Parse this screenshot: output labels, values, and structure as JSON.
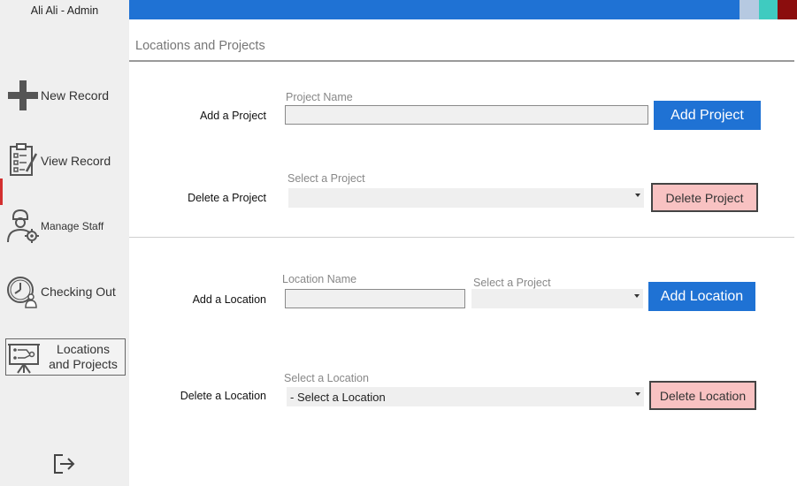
{
  "user": {
    "label": "Ali Ali - Admin"
  },
  "sidebar": {
    "items": [
      {
        "label": "New Record",
        "icon": "plus-icon"
      },
      {
        "label": "View Record",
        "icon": "clipboard-icon"
      },
      {
        "label": "Manage Staff",
        "icon": "staff-gear-icon"
      },
      {
        "label": "Checking Out",
        "icon": "clock-person-icon"
      },
      {
        "label": "Locations\nand Projects",
        "icon": "presentation-board-icon"
      }
    ],
    "logout_icon": "logout-icon"
  },
  "topbar": {
    "color": "#1f72d4",
    "swatches": [
      "#b6c9e1",
      "#3fcbc0",
      "#8b0d0d"
    ]
  },
  "page": {
    "title": "Locations and Projects"
  },
  "project": {
    "add_label": "Add a Project",
    "name_label": "Project Name",
    "name_value": "",
    "add_button": "Add Project",
    "delete_label": "Delete a Project",
    "select_label": "Select a Project",
    "select_value": "",
    "delete_button": "Delete Project"
  },
  "location": {
    "add_label": "Add a Location",
    "name_label": "Location Name",
    "name_value": "",
    "project_select_label": "Select a Project",
    "project_select_value": "",
    "add_button": "Add Location",
    "delete_label": "Delete a Location",
    "select_label": "Select a Location",
    "select_value": "-  Select a Location",
    "delete_button": "Delete Location"
  },
  "colors": {
    "primary": "#1f72d4",
    "danger_bg": "#f8c2c2",
    "sidebar_bg": "#efefef"
  }
}
